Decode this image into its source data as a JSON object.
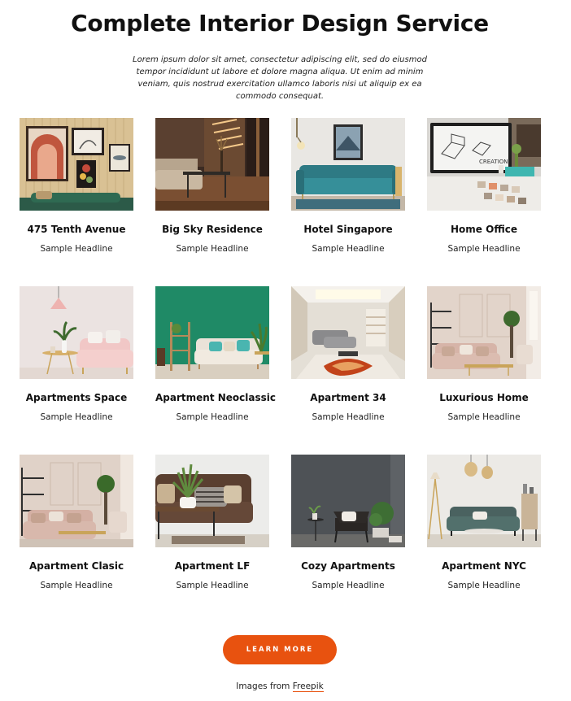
{
  "header": {
    "title": "Complete Interior Design Service",
    "intro": "Lorem ipsum dolor sit amet, consectetur adipiscing elit, sed do eiusmod tempor incididunt ut labore et dolore magna aliqua. Ut enim ad minim veniam, quis nostrud exercitation ullamco laboris nisi ut aliquip ex ea commodo consequat."
  },
  "projects": [
    {
      "title": "475 Tenth Avenue",
      "subtitle": "Sample Headline"
    },
    {
      "title": "Big Sky Residence",
      "subtitle": "Sample Headline"
    },
    {
      "title": "Hotel Singapore",
      "subtitle": "Sample Headline"
    },
    {
      "title": "Home Office",
      "subtitle": "Sample Headline"
    },
    {
      "title": "Apartments Space",
      "subtitle": "Sample Headline"
    },
    {
      "title": "Apartment Neoclassic",
      "subtitle": "Sample Headline"
    },
    {
      "title": "Apartment 34",
      "subtitle": "Sample Headline"
    },
    {
      "title": "Luxurious Home",
      "subtitle": "Sample Headline"
    },
    {
      "title": "Apartment Clasic",
      "subtitle": "Sample Headline"
    },
    {
      "title": "Apartment LF",
      "subtitle": "Sample Headline"
    },
    {
      "title": "Cozy Apartments",
      "subtitle": "Sample Headline"
    },
    {
      "title": "Apartment NYC",
      "subtitle": "Sample Headline"
    }
  ],
  "cta": {
    "label": "LEARN MORE"
  },
  "credit": {
    "prefix": "Images from ",
    "link": "Freepik"
  },
  "colors": {
    "accent": "#e8520f",
    "text": "#111111",
    "background": "#ffffff"
  }
}
